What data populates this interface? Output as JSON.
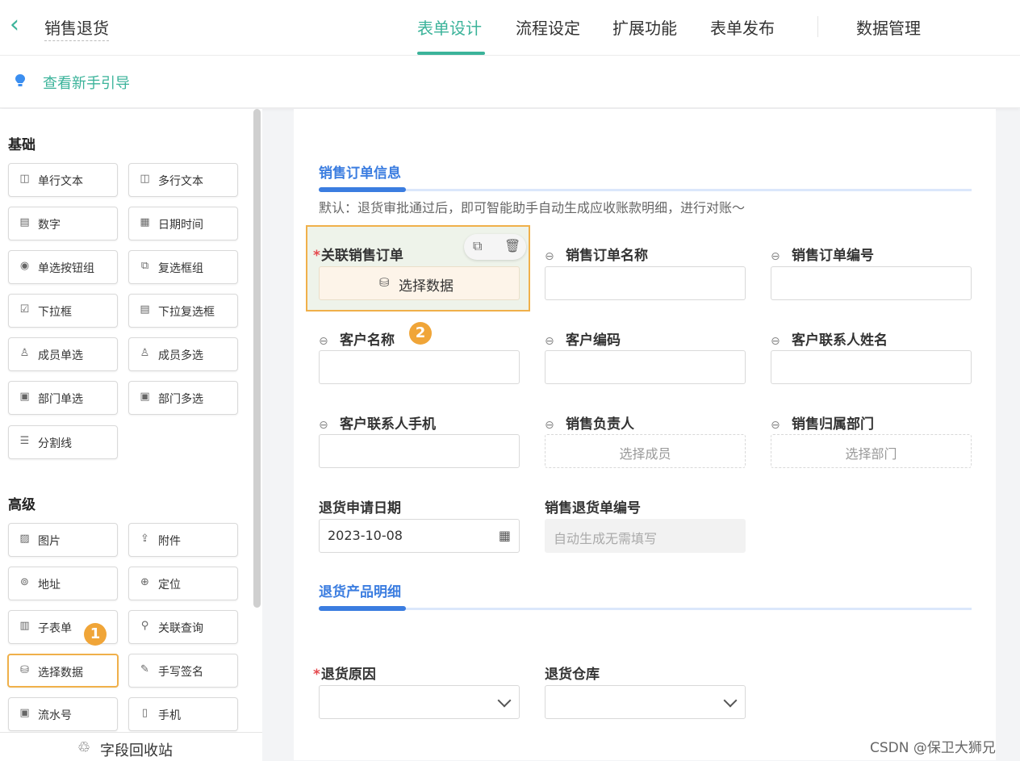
{
  "header": {
    "title": "销售退货",
    "tabs": [
      "表单设计",
      "流程设定",
      "扩展功能",
      "表单发布",
      "数据管理"
    ],
    "active_tab": "表单设计",
    "accent_color": "#3bb39a"
  },
  "guide": {
    "text": "查看新手引导"
  },
  "sidebar": {
    "basic_title": "基础",
    "basic": [
      {
        "label": "单行文本",
        "icon": "single-line-text-icon",
        "glyph": "◫"
      },
      {
        "label": "多行文本",
        "icon": "multi-line-text-icon",
        "glyph": "◫"
      },
      {
        "label": "数字",
        "icon": "number-icon",
        "glyph": "▤"
      },
      {
        "label": "日期时间",
        "icon": "calendar-icon",
        "glyph": "▦"
      },
      {
        "label": "单选按钮组",
        "icon": "radio-icon",
        "glyph": "◉"
      },
      {
        "label": "复选框组",
        "icon": "checkbox-group-icon",
        "glyph": "⧉"
      },
      {
        "label": "下拉框",
        "icon": "dropdown-icon",
        "glyph": "☑"
      },
      {
        "label": "下拉复选框",
        "icon": "dropdown-multi-icon",
        "glyph": "▤"
      },
      {
        "label": "成员单选",
        "icon": "member-icon",
        "glyph": "♙"
      },
      {
        "label": "成员多选",
        "icon": "members-icon",
        "glyph": "♙"
      },
      {
        "label": "部门单选",
        "icon": "department-icon",
        "glyph": "▣"
      },
      {
        "label": "部门多选",
        "icon": "departments-icon",
        "glyph": "▣"
      },
      {
        "label": "分割线",
        "icon": "divider-icon",
        "glyph": "☰"
      }
    ],
    "advanced_title": "高级",
    "advanced": [
      {
        "label": "图片",
        "icon": "image-icon",
        "glyph": "▨"
      },
      {
        "label": "附件",
        "icon": "attachment-icon",
        "glyph": "⇪"
      },
      {
        "label": "地址",
        "icon": "location-pin-icon",
        "glyph": "⊚"
      },
      {
        "label": "定位",
        "icon": "locate-icon",
        "glyph": "⊕"
      },
      {
        "label": "子表单",
        "icon": "subform-icon",
        "glyph": "▥"
      },
      {
        "label": "关联查询",
        "icon": "linked-query-icon",
        "glyph": "⚲"
      },
      {
        "label": "选择数据",
        "icon": "database-icon",
        "glyph": "⛁"
      },
      {
        "label": "手写签名",
        "icon": "pen-icon",
        "glyph": "✎"
      },
      {
        "label": "流水号",
        "icon": "serial-number-icon",
        "glyph": "▣"
      },
      {
        "label": "手机",
        "icon": "phone-icon",
        "glyph": "▯"
      }
    ],
    "badge1": "1",
    "recycle": "字段回收站"
  },
  "form": {
    "section1": "销售订单信息",
    "hint": "默认：退货审批通过后，即可智能助手自动生成应收账款明细，进行对账～",
    "f_order": "关联销售订单",
    "choose_btn": "选择数据",
    "f_order_name": "销售订单名称",
    "f_order_no": "销售订单编号",
    "f_customer": "客户名称",
    "badge2": "2",
    "f_customer_code": "客户编码",
    "f_contact_name": "客户联系人姓名",
    "f_contact_phone": "客户联系人手机",
    "f_sales_owner": "销售负责人",
    "ph_member": "选择成员",
    "f_sales_dept": "销售归属部门",
    "ph_dept": "选择部门",
    "f_return_date": "退货申请日期",
    "return_date_value": "2023-10-08",
    "f_return_no": "销售退货单编号",
    "ph_auto": "自动生成无需填写",
    "section2": "退货产品明细",
    "f_reason": "退货原因",
    "f_warehouse": "退货仓库"
  },
  "watermark": "CSDN @保卫大狮兄"
}
